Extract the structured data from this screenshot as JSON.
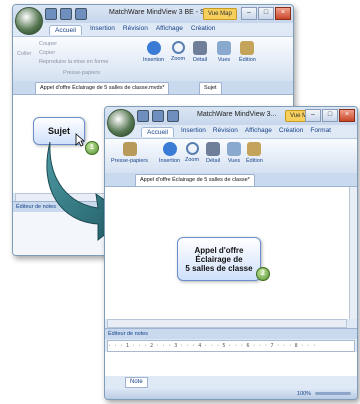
{
  "window1": {
    "title": "MatchWare MindView 3 BE - S...",
    "vue_map": "Vue Map",
    "tabs": [
      "Accueil",
      "Insertion",
      "Révision",
      "Affichage",
      "Création"
    ],
    "clipboard": {
      "couper": "Couper",
      "copier": "Copier",
      "reproduire": "Reproduire la mise en forme",
      "coller": "Coller",
      "group": "Presse-papiers"
    },
    "buttons": [
      "Insertion",
      "Zoom",
      "Détail",
      "Vues",
      "Édition"
    ],
    "doc_tabs": [
      "Appel d'offre Éclairage de 5 salles de classe.mvdx*",
      "Sujet"
    ],
    "node": "Sujet",
    "badge": "1",
    "notes_label": "Éditeur de notes"
  },
  "window2": {
    "title": "MatchWare MindView 3...",
    "vue_map": "Vue Map",
    "tabs": [
      "Accueil",
      "Insertion",
      "Révision",
      "Affichage",
      "Création",
      "Format"
    ],
    "group": "Presse-papiers",
    "buttons": [
      "Insertion",
      "Zoom",
      "Détail",
      "Vues",
      "Édition"
    ],
    "doc_tab": "Appel d'offre Éclairage de 5 salles de classe*",
    "node_lines": [
      "Appel d'offre",
      "Éclairage de",
      "5 salles de classe"
    ],
    "badge": "2",
    "notes_label": "Éditeur de notes",
    "ruler": "· · · 1 · · · 2 · · · 3 · · · 4 · · · 5 · · · 6 · · · 7 · · · 8 · · ·",
    "bottom_tab": "Note",
    "zoom": "100%"
  },
  "colors": {
    "accent": "#15428b",
    "node_border": "#6b8fc9",
    "arrow": "#2a6a73"
  }
}
